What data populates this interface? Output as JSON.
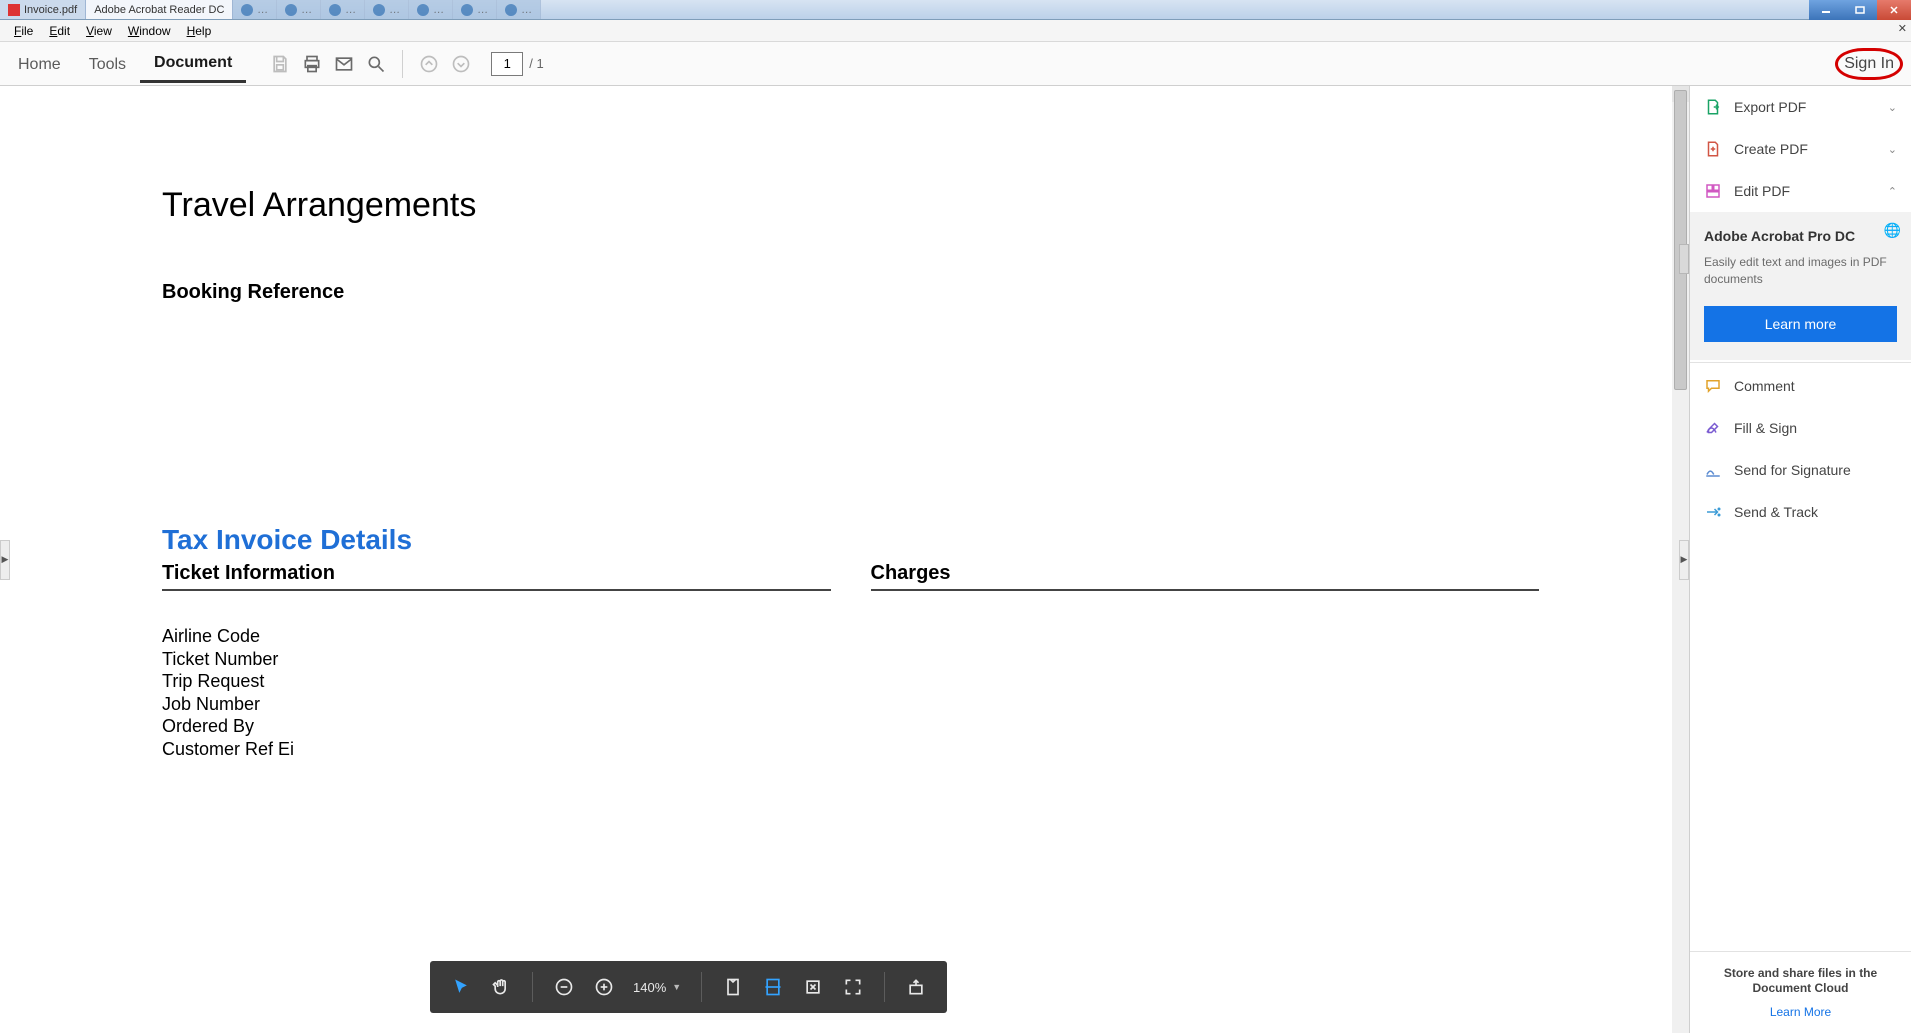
{
  "window": {
    "tabs": [
      {
        "label": "Invoice.pdf",
        "kind": "pdf",
        "active": false
      },
      {
        "label": "Adobe Acrobat Reader DC",
        "kind": "app",
        "active": true
      }
    ]
  },
  "menubar": [
    "File",
    "Edit",
    "View",
    "Window",
    "Help"
  ],
  "toolbar": {
    "nav": {
      "home": "Home",
      "tools": "Tools",
      "document": "Document"
    },
    "active_nav": "document",
    "page_current": "1",
    "page_total": "1",
    "signin": "Sign In"
  },
  "document": {
    "title": "Travel Arrangements",
    "subtitle": "Booking Reference",
    "tax_title": "Tax Invoice Details",
    "section1": "Ticket Information",
    "section2": "Charges",
    "fields": [
      "Airline Code",
      "Ticket Number",
      "Trip Request",
      "Job Number",
      "Ordered By",
      "Customer Ref Ei"
    ]
  },
  "tools_pane": {
    "export": "Export PDF",
    "create": "Create PDF",
    "edit": "Edit PDF",
    "panel_title": "Adobe Acrobat Pro DC",
    "panel_text": "Easily edit text and images in PDF documents",
    "panel_cta": "Learn more",
    "comment": "Comment",
    "fill": "Fill & Sign",
    "sendSig": "Send for Signature",
    "sendTrack": "Send & Track",
    "footer1": "Store and share files in the Document Cloud",
    "footer2": "Learn More"
  },
  "floatbar": {
    "zoom": "140%"
  }
}
